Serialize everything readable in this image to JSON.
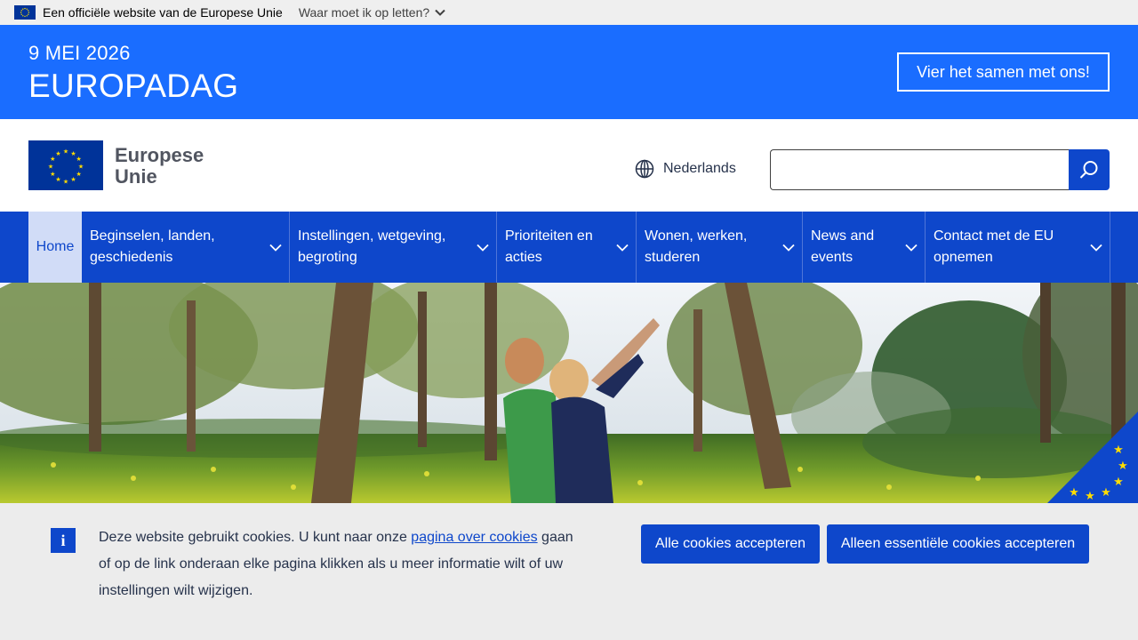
{
  "official_bar": {
    "text": "Een officiële website van de Europese Unie",
    "link": "Waar moet ik op letten?"
  },
  "banner": {
    "date": "9 MEI 2026",
    "title": "EUROPADAG",
    "button": "Vier het samen met ons!"
  },
  "header": {
    "logo_line1": "Europese",
    "logo_line2": "Unie",
    "language": "Nederlands",
    "search_placeholder": "",
    "search_value": ""
  },
  "nav": {
    "home": "Home",
    "items": [
      {
        "label": "Beginselen, landen, geschiedenis"
      },
      {
        "label": "Instellingen, wetgeving, begroting"
      },
      {
        "label": "Prioriteiten en acties"
      },
      {
        "label": "Wonen, werken, studeren"
      },
      {
        "label": "News and events"
      },
      {
        "label": "Contact met de EU opnemen"
      }
    ]
  },
  "cookie": {
    "text_before": "Deze website gebruikt cookies. U kunt naar onze ",
    "link": "pagina over cookies",
    "text_after": " gaan of op de link onderaan elke pagina klikken als u meer informatie wilt of uw instellingen wilt wijzigen.",
    "icon": "i",
    "accept_all": "Alle cookies accepteren",
    "accept_essential": "Alleen essentiële cookies accepteren"
  },
  "colors": {
    "banner_blue": "#1a6dff",
    "eu_blue": "#0e47cb",
    "flag_blue": "#003399",
    "star_yellow": "#ffdd00",
    "home_tab_bg": "#d1dcf7",
    "cookie_bg": "#ececec"
  }
}
